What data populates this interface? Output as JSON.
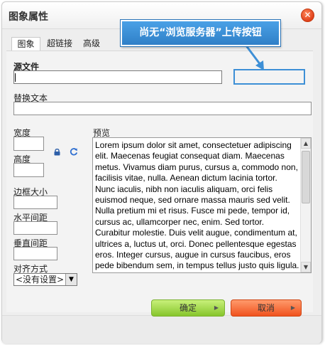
{
  "dialog": {
    "title": "图象属性",
    "close_icon": "close-icon",
    "close_glyph": "✕"
  },
  "tabs": [
    {
      "label": "图象",
      "active": true
    },
    {
      "label": "超链接",
      "active": false
    },
    {
      "label": "高级",
      "active": false
    }
  ],
  "form": {
    "source_label": "源文件",
    "source_value": "",
    "alt_label": "替换文本",
    "alt_value": "",
    "width_label": "宽度",
    "height_label": "高度",
    "border_label": "边框大小",
    "hspace_label": "水平间距",
    "vspace_label": "垂直间距",
    "align_label": "对齐方式",
    "align_value": "<没有设置>",
    "lock_icon": "lock-icon",
    "reset_icon": "refresh-icon"
  },
  "preview": {
    "label": "预览",
    "text": "Lorem ipsum dolor sit amet, consectetuer adipiscing elit. Maecenas feugiat consequat diam. Maecenas metus. Vivamus diam purus, cursus a, commodo non, facilisis vitae, nulla. Aenean dictum lacinia tortor. Nunc iaculis, nibh non iaculis aliquam, orci felis euismod neque, sed ornare massa mauris sed velit. Nulla pretium mi et risus. Fusce mi pede, tempor id, cursus ac, ullamcorper nec, enim. Sed tortor. Curabitur molestie. Duis velit augue, condimentum at, ultrices a, luctus ut, orci. Donec pellentesque egestas eros. Integer cursus, augue in cursus faucibus, eros pede bibendum sem, in tempus tellus justo quis ligula. Etiam eget tortor."
  },
  "annotation": {
    "callout_text": "尚无“浏览服务器”上传按钮"
  },
  "buttons": {
    "ok_label": "确定",
    "cancel_label": "取消",
    "arrow_glyph": "▶"
  },
  "colors": {
    "accent": "#3d8fd6",
    "ok_button": "#8dcb31",
    "cancel_button": "#f0521e",
    "close_button": "#e0401a"
  }
}
